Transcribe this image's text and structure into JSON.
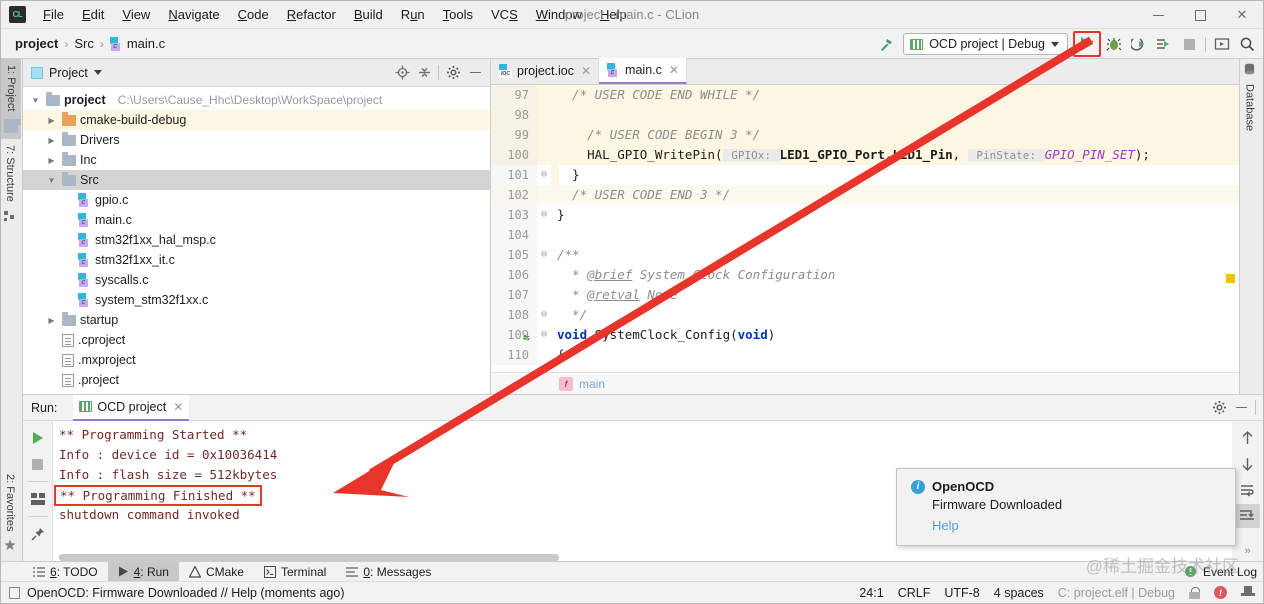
{
  "window": {
    "title": "project - main.c - CLion",
    "logo_text": "CL",
    "minimize_label": "Minimize",
    "maximize_label": "Maximize",
    "close_label": "Close"
  },
  "menu": [
    {
      "label": "File"
    },
    {
      "label": "Edit"
    },
    {
      "label": "View"
    },
    {
      "label": "Navigate"
    },
    {
      "label": "Code"
    },
    {
      "label": "Refactor"
    },
    {
      "label": "Build"
    },
    {
      "label": "Run"
    },
    {
      "label": "Tools"
    },
    {
      "label": "VCS"
    },
    {
      "label": "Window"
    },
    {
      "label": "Help"
    }
  ],
  "breadcrumb": {
    "items": [
      "project",
      "Src",
      "main.c"
    ],
    "sep": "›"
  },
  "toolbar": {
    "build_icon": "hammer-icon",
    "run_config": "OCD project | Debug",
    "run_label": "Run",
    "debug_label": "Debug",
    "attach_label": "Attach to Process",
    "profile_label": "Profile",
    "stop_label": "Stop",
    "update_label": "Update Application",
    "search_label": "Search Everywhere"
  },
  "left_stripe": [
    {
      "label": "1: Project",
      "active": true,
      "icon": "project-folder-icon"
    },
    {
      "label": "7: Structure",
      "active": false,
      "icon": "structure-icon"
    }
  ],
  "left_stripe_bottom": [
    {
      "label": "2: Favorites",
      "icon": "star-icon"
    }
  ],
  "right_stripe": [
    {
      "label": "Database",
      "icon": "database-icon"
    }
  ],
  "project_pane": {
    "title": "Project",
    "icons": [
      "locate-icon",
      "collapse-all-icon",
      "gear-icon",
      "minimize-icon"
    ],
    "tree": [
      {
        "label": "project",
        "path": "C:\\Users\\Cause_Hhc\\Desktop\\WorkSpace\\project",
        "indent": 0,
        "arrow": "▼",
        "kind": "folder",
        "state": "none"
      },
      {
        "label": "cmake-build-debug",
        "path": "",
        "indent": 1,
        "arrow": "▶",
        "kind": "folder-orange",
        "state": "highlight"
      },
      {
        "label": "Drivers",
        "path": "",
        "indent": 1,
        "arrow": "▶",
        "kind": "folder",
        "state": "none"
      },
      {
        "label": "Inc",
        "path": "",
        "indent": 1,
        "arrow": "▶",
        "kind": "folder",
        "state": "none"
      },
      {
        "label": "Src",
        "path": "",
        "indent": 1,
        "arrow": "▼",
        "kind": "folder",
        "state": "selected"
      },
      {
        "label": "gpio.c",
        "path": "",
        "indent": 2,
        "arrow": "",
        "kind": "cfile",
        "state": "none"
      },
      {
        "label": "main.c",
        "path": "",
        "indent": 2,
        "arrow": "",
        "kind": "cfile",
        "state": "none"
      },
      {
        "label": "stm32f1xx_hal_msp.c",
        "path": "",
        "indent": 2,
        "arrow": "",
        "kind": "cfile",
        "state": "none"
      },
      {
        "label": "stm32f1xx_it.c",
        "path": "",
        "indent": 2,
        "arrow": "",
        "kind": "cfile",
        "state": "none"
      },
      {
        "label": "syscalls.c",
        "path": "",
        "indent": 2,
        "arrow": "",
        "kind": "cfile",
        "state": "none"
      },
      {
        "label": "system_stm32f1xx.c",
        "path": "",
        "indent": 2,
        "arrow": "",
        "kind": "cfile",
        "state": "none"
      },
      {
        "label": "startup",
        "path": "",
        "indent": 1,
        "arrow": "▶",
        "kind": "folder",
        "state": "none"
      },
      {
        "label": ".cproject",
        "path": "",
        "indent": 1,
        "arrow": "",
        "kind": "xfile",
        "state": "none"
      },
      {
        "label": ".mxproject",
        "path": "",
        "indent": 1,
        "arrow": "",
        "kind": "xfile",
        "state": "none"
      },
      {
        "label": ".project",
        "path": "",
        "indent": 1,
        "arrow": "",
        "kind": "xfile",
        "state": "none"
      }
    ]
  },
  "editor": {
    "tabs": [
      {
        "label": "project.ioc",
        "icon": "ioc-file-icon",
        "active": false
      },
      {
        "label": "main.c",
        "icon": "c-file-icon",
        "active": true
      }
    ],
    "lines": [
      {
        "num": "97",
        "fold": "",
        "highlight": "band",
        "segments": [
          {
            "t": "  /* USER CODE END WHILE */",
            "c": "cmt"
          }
        ]
      },
      {
        "num": "98",
        "fold": "",
        "highlight": "band",
        "segments": [
          {
            "t": "",
            "c": "plain"
          }
        ]
      },
      {
        "num": "99",
        "fold": "",
        "highlight": "band",
        "segments": [
          {
            "t": "    /* USER CODE BEGIN 3 */",
            "c": "cmt"
          }
        ]
      },
      {
        "num": "100",
        "fold": "",
        "highlight": "band",
        "segments": [
          {
            "t": "    HAL_GPIO_WritePin(",
            "c": "plain"
          },
          {
            "t": " GPIOx: ",
            "c": "hint"
          },
          {
            "t": "LED1_GPIO_Port,LED1_Pin",
            "c": "bold"
          },
          {
            "t": ", ",
            "c": "plain"
          },
          {
            "t": " PinState: ",
            "c": "hint"
          },
          {
            "t": "GPIO_PIN_SET",
            "c": "macro"
          },
          {
            "t": ");",
            "c": "plain"
          }
        ]
      },
      {
        "num": "101",
        "fold": "⊖",
        "highlight": "band-white",
        "segments": [
          {
            "t": "  }",
            "c": "plain"
          }
        ]
      },
      {
        "num": "102",
        "fold": "",
        "highlight": "soft",
        "segments": [
          {
            "t": "  /* USER CODE END 3 */",
            "c": "cmt"
          }
        ]
      },
      {
        "num": "103",
        "fold": "⊖",
        "highlight": "none",
        "segments": [
          {
            "t": "}",
            "c": "plain"
          }
        ]
      },
      {
        "num": "104",
        "fold": "",
        "highlight": "none",
        "segments": [
          {
            "t": "",
            "c": "plain"
          }
        ]
      },
      {
        "num": "105",
        "fold": "⊖",
        "highlight": "none",
        "segments": [
          {
            "t": "/**",
            "c": "cmt"
          }
        ]
      },
      {
        "num": "106",
        "fold": "",
        "highlight": "none",
        "segments": [
          {
            "t": "  * ",
            "c": "cmt"
          },
          {
            "t": "@brief",
            "c": "doctag"
          },
          {
            "t": " System Clock Configuration",
            "c": "cmt"
          }
        ]
      },
      {
        "num": "107",
        "fold": "",
        "highlight": "none",
        "segments": [
          {
            "t": "  * ",
            "c": "cmt"
          },
          {
            "t": "@retval",
            "c": "doctag"
          },
          {
            "t": " None",
            "c": "cmt"
          }
        ]
      },
      {
        "num": "108",
        "fold": "⊖",
        "highlight": "none",
        "segments": [
          {
            "t": "  */",
            "c": "cmt"
          }
        ]
      },
      {
        "num": "109",
        "fold": "⊖",
        "gutterMark": "override-icon",
        "highlight": "none",
        "segments": [
          {
            "t": "void",
            "c": "kw"
          },
          {
            "t": " SystemClock_Config(",
            "c": "plain"
          },
          {
            "t": "void",
            "c": "kw"
          },
          {
            "t": ")",
            "c": "plain"
          }
        ]
      },
      {
        "num": "110",
        "fold": "",
        "highlight": "none",
        "segments": [
          {
            "t": "{",
            "c": "plain"
          }
        ]
      }
    ],
    "function_breadcrumb": {
      "badge": "f",
      "label": "main"
    }
  },
  "run_pane": {
    "label": "Run:",
    "tab": "OCD project",
    "tools_left": [
      "rerun-icon",
      "stop-icon",
      "layout-icon",
      "pin-icon"
    ],
    "tools_right": [
      "up-arrow-icon",
      "down-arrow-icon",
      "soft-wrap-icon",
      "scroll-to-end-icon",
      "expand-icon"
    ],
    "header_icons": [
      "gear-icon",
      "minimize-icon"
    ],
    "console": [
      {
        "text": "** Programming Started **",
        "boxed": false
      },
      {
        "text": "Info : device id = 0x10036414",
        "boxed": false
      },
      {
        "text": "Info : flash size = 512kbytes",
        "boxed": false
      },
      {
        "text": "** Programming Finished **",
        "boxed": true
      },
      {
        "text": "shutdown command invoked",
        "boxed": false
      }
    ]
  },
  "notification": {
    "icon": "info-icon",
    "title": "OpenOCD",
    "message": "Firmware Downloaded",
    "link": "Help"
  },
  "bottom_stripe": [
    {
      "label": "6: TODO",
      "icon": "todo-icon",
      "active": false
    },
    {
      "label": "4: Run",
      "icon": "run-icon",
      "active": true
    },
    {
      "label": "CMake",
      "icon": "cmake-icon",
      "active": false
    },
    {
      "label": "Terminal",
      "icon": "terminal-icon",
      "active": false
    },
    {
      "label": "0: Messages",
      "icon": "messages-icon",
      "active": false
    }
  ],
  "bottom_stripe_right": {
    "label": "Event Log",
    "icon": "event-log-icon"
  },
  "statusbar": {
    "message": "OpenOCD: Firmware Downloaded // Help (moments ago)",
    "caret": "24:1",
    "line_sep": "CRLF",
    "encoding": "UTF-8",
    "indent": "4 spaces",
    "config": "C: project.elf | Debug",
    "icons": [
      "lock-icon",
      "error-icon",
      "hat-icon"
    ]
  },
  "watermark": "@稀土掘金技术社区",
  "colors": {
    "accent_green": "#4caf50",
    "highlight_red": "#e8352c",
    "selection_gray": "#d4d4d4",
    "code_highlight": "#fdf6e3",
    "link_blue": "#5a9ad4"
  }
}
